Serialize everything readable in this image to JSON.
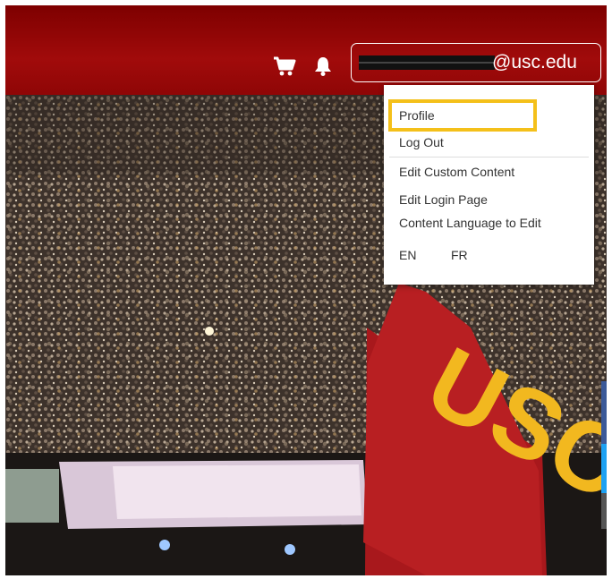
{
  "header": {
    "user": {
      "email": "@usc.edu"
    }
  },
  "user_menu": {
    "items": [
      {
        "label": "Profile"
      },
      {
        "label": "Log Out"
      },
      {
        "label": "Edit Custom Content"
      },
      {
        "label": "Edit Login Page"
      },
      {
        "label": "Content Language to Edit"
      }
    ],
    "languages": [
      "EN",
      "FR"
    ]
  },
  "hero": {
    "flag_text": "USC"
  },
  "colors": {
    "header_red": "#990000",
    "highlight_gold": "#f4c01a",
    "flag_red": "#a8181c",
    "flag_gold": "#f2b81f"
  },
  "icons": {
    "cart": "shopping-cart-icon",
    "bell": "bell-icon"
  }
}
